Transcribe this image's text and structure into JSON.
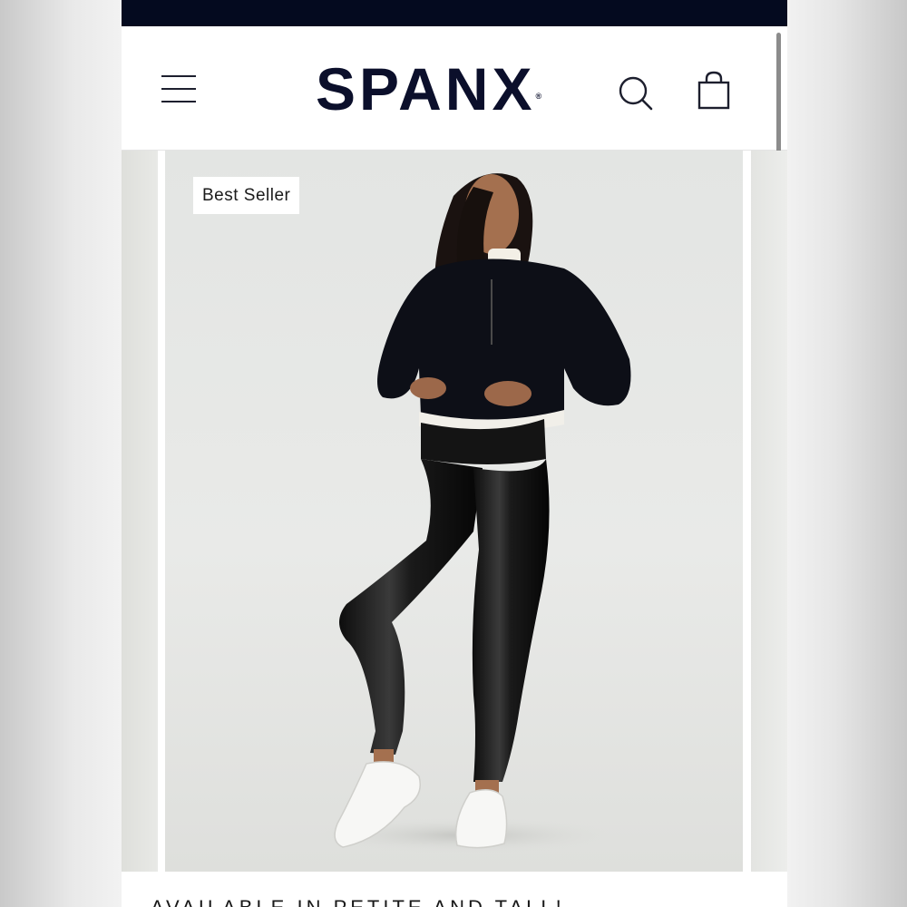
{
  "header": {
    "brand": "SPANX",
    "brand_mark": "®",
    "icons": {
      "menu": "hamburger-menu-icon",
      "search": "search-icon",
      "cart": "shopping-bag-icon"
    },
    "colors": {
      "status_bar": "#040a1f",
      "brand": "#0b0f2b"
    }
  },
  "product": {
    "badge": "Best Seller",
    "image": "model-in-faux-leather-leggings"
  },
  "promo": {
    "text": "AVAILABLE IN PETITE AND TALL!"
  }
}
